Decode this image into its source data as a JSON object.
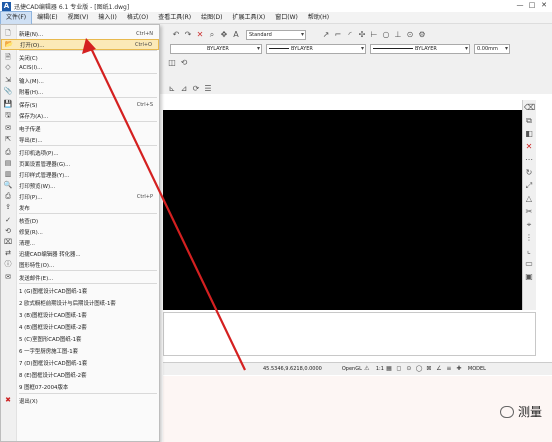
{
  "window": {
    "app_icon": "A",
    "title": "迅捷CAD编辑器 6.1 专业版 - [图纸1.dwg]",
    "buttons": [
      "—",
      "□",
      "✕"
    ]
  },
  "menubar": [
    "文件(F)",
    "编辑(E)",
    "视图(V)",
    "输入(I)",
    "格式(O)",
    "查看工具(R)",
    "绘图(D)",
    "扩展工具(X)",
    "窗口(W)",
    "帮助(H)"
  ],
  "toolbar": {
    "text_style": "Standard",
    "layer1": "BYLAYER",
    "layer2": "BYLAYER",
    "layer3": "BYLAYER",
    "lineweight": "0.00mm"
  },
  "file_menu": {
    "items": [
      {
        "label": "新建(N)...",
        "shortcut": "Ctrl+N",
        "icon": "new-file-icon"
      },
      {
        "label": "打开(O)...",
        "shortcut": "Ctrl+O",
        "icon": "open-folder-icon",
        "highlight": true
      },
      {
        "label": "关闭(C)",
        "shortcut": "",
        "icon": "close-file-icon"
      },
      {
        "label": "ACIS(I)...",
        "shortcut": "",
        "icon": "acis-icon"
      },
      {
        "label": "输入(M)...",
        "shortcut": "",
        "icon": "import-icon"
      },
      {
        "label": "附着(H)...",
        "shortcut": "",
        "icon": "attach-icon"
      },
      {
        "label": "保存(S)",
        "shortcut": "Ctrl+S",
        "icon": "save-icon"
      },
      {
        "label": "保存为(A)...",
        "shortcut": "",
        "icon": "save-as-icon"
      },
      {
        "label": "电子传递",
        "shortcut": "",
        "icon": "etransmit-icon"
      },
      {
        "label": "导出(E)...",
        "shortcut": "",
        "icon": "export-icon"
      },
      {
        "label": "打印机选项(P)...",
        "shortcut": "",
        "icon": "printer-options-icon"
      },
      {
        "label": "页面设置管理器(G)...",
        "shortcut": "",
        "icon": "page-setup-icon"
      },
      {
        "label": "打印样式管理器(Y)...",
        "shortcut": "",
        "icon": "plot-style-icon"
      },
      {
        "label": "打印预览(W)...",
        "shortcut": "",
        "icon": "print-preview-icon"
      },
      {
        "label": "打印(P)...",
        "shortcut": "Ctrl+P",
        "icon": "print-icon"
      },
      {
        "label": "发布",
        "shortcut": "",
        "icon": "publish-icon"
      },
      {
        "label": "核查(D)",
        "shortcut": "",
        "icon": "audit-icon"
      },
      {
        "label": "修复(R)...",
        "shortcut": "",
        "icon": "recover-icon"
      },
      {
        "label": "清理...",
        "shortcut": "",
        "icon": "purge-icon"
      },
      {
        "label": "迅捷CAD编辑器 转化器...",
        "shortcut": "",
        "icon": "converter-icon"
      },
      {
        "label": "图形特性(O)...",
        "shortcut": "",
        "icon": "drawing-properties-icon"
      },
      {
        "label": "发送邮件(E)...",
        "shortcut": "",
        "icon": "send-mail-icon"
      },
      {
        "label": "1 (G)图框设计CAD图纸-1套",
        "shortcut": "",
        "icon": ""
      },
      {
        "label": "2 欧式橱柜前期设计与后期设计图纸-1套",
        "shortcut": "",
        "icon": ""
      },
      {
        "label": "3 (B)图框设计CAD图纸-1套",
        "shortcut": "",
        "icon": ""
      },
      {
        "label": "4 (B)图框设计CAD图纸-2套",
        "shortcut": "",
        "icon": ""
      },
      {
        "label": "5 (C)室图形CAD图纸-1套",
        "shortcut": "",
        "icon": ""
      },
      {
        "label": "6 一字型厨房施工图-1套",
        "shortcut": "",
        "icon": ""
      },
      {
        "label": "7 (D)图框设计CAD图纸-1套",
        "shortcut": "",
        "icon": ""
      },
      {
        "label": "8 (E)图框设计CAD图纸-2套",
        "shortcut": "",
        "icon": ""
      },
      {
        "label": "9 图框07-2004版本",
        "shortcut": "",
        "icon": ""
      },
      {
        "label": "退出(X)",
        "shortcut": "",
        "icon": "exit-icon"
      }
    ]
  },
  "status": {
    "coords": "45.5346,9.6218,0.0000",
    "opengl": "OpenGL",
    "scale": "1:1",
    "model": "MODEL"
  },
  "watermark": "测量",
  "colors": {
    "arrow": "#d42020",
    "highlight": "#fbe9b7",
    "canvas": "#000000"
  }
}
